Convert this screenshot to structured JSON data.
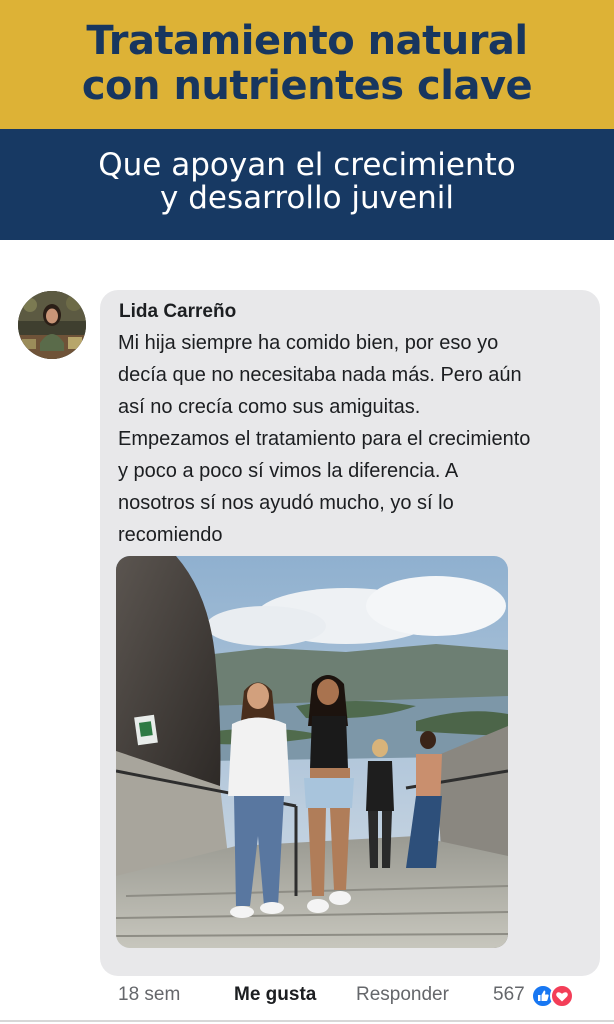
{
  "header": {
    "headline_line1": "Tratamiento natural",
    "headline_line2": "con nutrientes clave",
    "subheadline_line1": "Que apoyan el crecimiento",
    "subheadline_line2": "y desarrollo juvenil",
    "colors": {
      "gold": "#ddb236",
      "navy": "#173963",
      "headline_text": "#17365f"
    }
  },
  "comment": {
    "author": "Lida Carreño",
    "text_lines": [
      "Mi hija siempre ha comido bien, por eso yo",
      "decía que no necesitaba nada más. Pero aún",
      "así no crecía como sus amiguitas.",
      "Empezamos el tratamiento para el crecimiento",
      "y poco a poco sí vimos la diferencia. A",
      "nosotros sí nos ayudó mucho, yo sí lo",
      "recomiendo"
    ],
    "avatar_icon": "profile-photo",
    "photo_icon": "attached-photo"
  },
  "actions": {
    "time": "18 sem",
    "like": "Me gusta",
    "reply": "Responder",
    "reaction_count": "567",
    "reaction_icons": [
      "like-reaction-icon",
      "love-reaction-icon"
    ],
    "colors": {
      "like_blue": "#1877f2",
      "love_red": "#f33e58"
    }
  }
}
